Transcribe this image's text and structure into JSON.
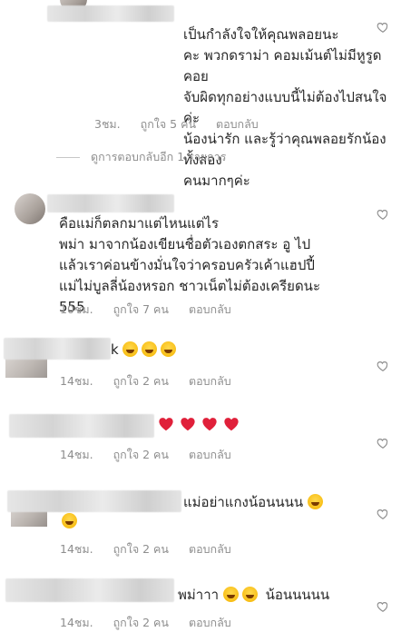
{
  "comments": [
    {
      "text": "เป็นกำลังใจให้คุณพลอยนะ\nคะ พวกดราม่า คอมเม้นต์ไม่มีหูรูด คอย\nจับผิดทุกอย่างแบบนี้ไม่ต้องไปสนใจค่ะ\nน้องน่ารัก และรู้ว่าคุณพลอยรักน้องทั้งสอง\nคนมากๆค่ะ",
      "emoji": "😘",
      "time": "3ชม.",
      "likes": "ถูกใจ 5 คน",
      "reply": "ตอบกลับ"
    },
    {
      "text": "คือแม่ก็ตลกมาแต่ไหนแต่ไร\nพม่า มาจากน้องเขียนชื่อตัวเองตกสระ อู ไป\nแล้วเราค่อนข้างมั่นใจว่าครอบครัวเค้าแฮปปี้\nแม่ไม่บูลลี่น้องหรอก ชาวเน็ตไม่ต้องเครียดนะ\n555",
      "time": "10ชม.",
      "likes": "ถูกใจ 7 คน",
      "reply": "ตอบกลับ"
    },
    {
      "text": "k",
      "time": "14ชม.",
      "likes": "ถูกใจ 2 คน",
      "reply": "ตอบกลับ"
    },
    {
      "time": "14ชม.",
      "likes": "ถูกใจ 2 คน",
      "reply": "ตอบกลับ"
    },
    {
      "text": "แม่อย่าแกงน้อนนนน",
      "time": "14ชม.",
      "likes": "ถูกใจ 2 คน",
      "reply": "ตอบกลับ"
    },
    {
      "text": "พม่าาา",
      "text2": "น้อนนนนน",
      "time": "14ชม.",
      "likes": "ถูกใจ 2 คน",
      "reply": "ตอบกลับ"
    }
  ],
  "view_replies": "ดูการตอบกลับอีก 1 รายการ",
  "icons": {
    "like": "heart-outline-icon",
    "emoji_heart": "red-heart-icon",
    "emoji_laugh": "tears-of-joy-icon",
    "emoji_rofl": "rofl-icon"
  }
}
